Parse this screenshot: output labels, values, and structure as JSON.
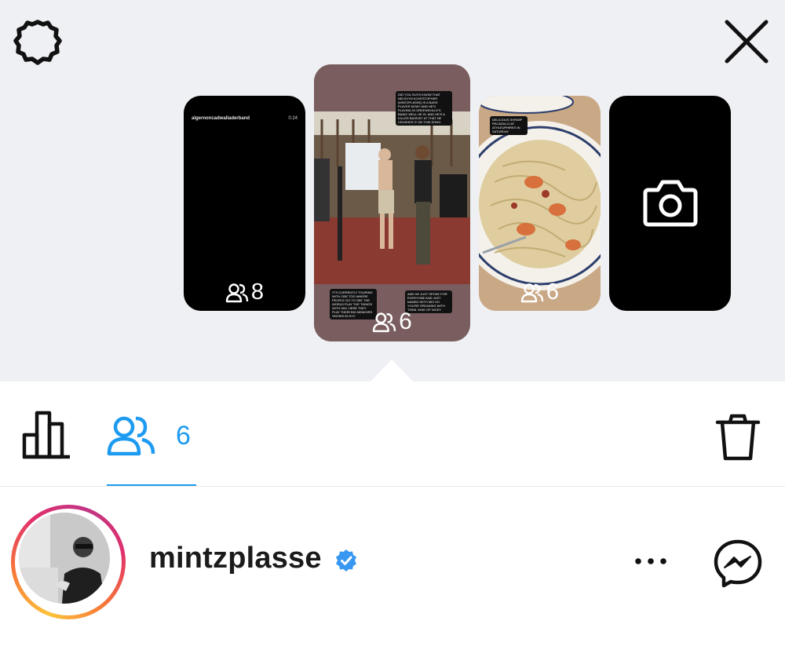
{
  "header": {
    "settings_icon": "settings-gear-icon",
    "close_icon": "close-icon"
  },
  "stories": [
    {
      "username": "algernoncadwalladerband",
      "time": "0:24",
      "viewers": "8"
    },
    {
      "viewers": "6",
      "captions": [
        "DID YOU GUYS KNOW THAT NELSVYN KOVESTOPHER (MINTZPLASSE) IS A BASS PLAYER NOW? AND HE'S PLAYING IN GREENSVILLE'S BAND! WELL HE IS. AND HE'S A KILLER BASSIST AT THAT HE CRUSHES IT ON THIS SONG",
        "IT'S CURRENTLY TOURING WITH ODE TOO WHERE PEOPLE GO TO SEE THE WORLD PLAY THE THINGS WITH HIM. HERE THEY PLAY THEIR BIG MEMOIRS SHOWS IN NYC",
        "AND HE JUST SPOKE FOR EVERYONE AND JUST NAMED WITH ME! SO YOU'RE SPEAKING WITH THEM. KIND OF NICE!!"
      ]
    },
    {
      "viewers": "6",
      "caption": "DELICIOUS SHRIMP PECADILLO AT ATHLEUPHIRES IN SATURDAY"
    },
    {
      "icon": "camera-icon"
    }
  ],
  "toolbar": {
    "stats_icon": "bar-chart-icon",
    "viewers_icon": "viewers-icon",
    "viewers_count": "6",
    "trash_icon": "trash-icon"
  },
  "viewer_row": {
    "username": "mintzplasse",
    "verified": true,
    "more_icon": "more-horizontal-icon",
    "messenger_icon": "messenger-icon"
  },
  "colors": {
    "accent": "#1d9bf0",
    "top_background": "#eff0f4",
    "verified": "#3897f0"
  }
}
